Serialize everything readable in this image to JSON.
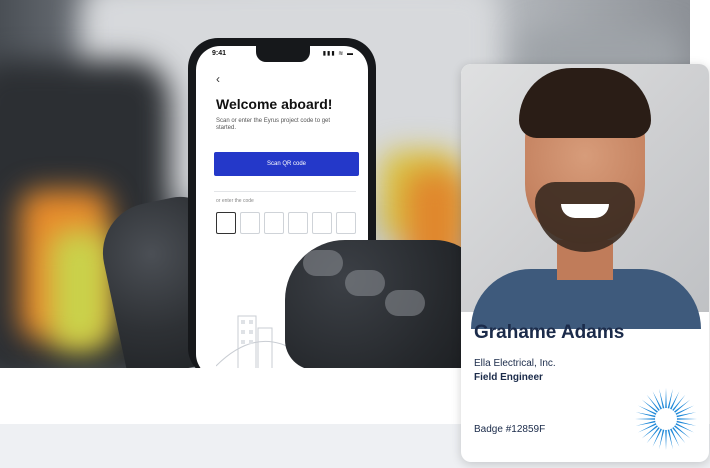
{
  "phone": {
    "status_time": "9:41",
    "status_icons": "▮▮▮ ≋ ▬",
    "back_icon": "‹",
    "title": "Welcome aboard!",
    "subtitle": "Scan or enter the Eyrus project code to get started.",
    "scan_button_label": "Scan QR code",
    "or_enter_label": "or enter the code",
    "code_box_count": 6
  },
  "badge": {
    "name": "Grahame Adams",
    "company": "Ella Electrical, Inc.",
    "role": "Field Engineer",
    "badge_number": "Badge #12859F",
    "logo_icon": "sunburst-logo-icon",
    "accent_color": "#1e88d8"
  },
  "colors": {
    "button_blue": "#2438c9",
    "name_navy": "#1b2b4a"
  }
}
